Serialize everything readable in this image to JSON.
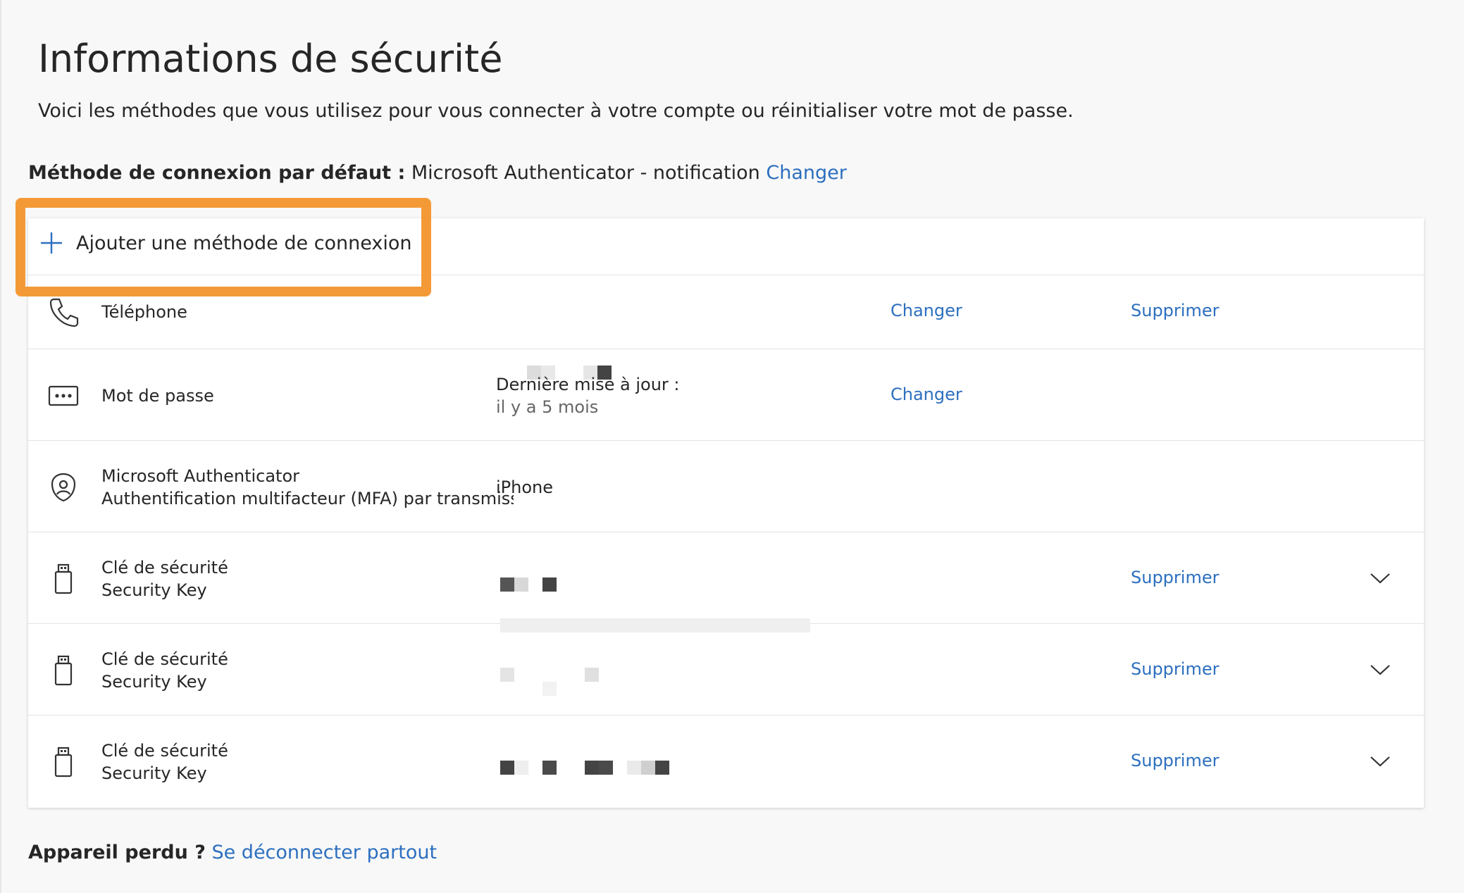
{
  "header": {
    "title": "Informations de sécurité",
    "subtitle": "Voici les méthodes que vous utilisez pour vous connecter à votre compte ou réinitialiser votre mot de passe."
  },
  "default_method": {
    "label": "Méthode de connexion par défaut :",
    "value": "Microsoft Authenticator - notification",
    "change_link": "Changer"
  },
  "add_method": {
    "label": "Ajouter une méthode de connexion",
    "highlight_color": "#f39a37"
  },
  "methods": [
    {
      "icon": "phone-icon",
      "name": "Téléphone",
      "name2": "",
      "detail": "",
      "detail2": "",
      "change": "Changer",
      "delete": "Supprimer"
    },
    {
      "icon": "password-icon",
      "name": "Mot de passe",
      "name2": "",
      "detail": "Dernière mise à jour :",
      "detail2": "il y a 5 mois",
      "change": "Changer",
      "delete": ""
    },
    {
      "icon": "authenticator-icon",
      "name": "Microsoft Authenticator",
      "name2": "Authentification multifacteur (MFA) par transmission",
      "detail": "iPhone",
      "detail2": "",
      "change": "",
      "delete": ""
    },
    {
      "icon": "usb-key-icon",
      "name": "Clé de sécurité",
      "name2": "Security Key",
      "detail": "",
      "detail2": "",
      "change": "",
      "delete": "Supprimer"
    },
    {
      "icon": "usb-key-icon",
      "name": "Clé de sécurité",
      "name2": "Security Key",
      "detail": "",
      "detail2": "",
      "change": "",
      "delete": "Supprimer"
    },
    {
      "icon": "usb-key-icon",
      "name": "Clé de sécurité",
      "name2": "Security Key",
      "detail": "",
      "detail2": "",
      "change": "",
      "delete": "Supprimer"
    }
  ],
  "footer": {
    "label": "Appareil perdu ?",
    "link": "Se déconnecter partout"
  },
  "colors": {
    "link": "#2c6fbf",
    "highlight": "#f39a37",
    "background": "#f8f8f8"
  }
}
